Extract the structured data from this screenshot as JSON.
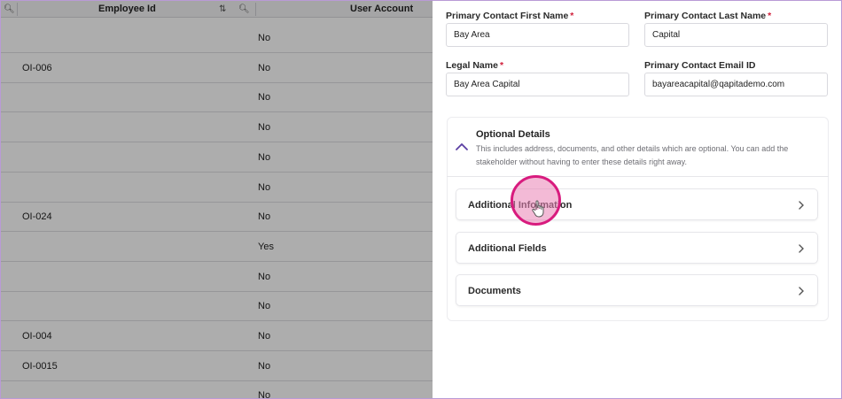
{
  "table": {
    "headers": {
      "employee_id": "Employee Id",
      "user_account": "User Account"
    },
    "rows": [
      {
        "employee_id": "",
        "user_account": "No"
      },
      {
        "employee_id": "OI-006",
        "user_account": "No"
      },
      {
        "employee_id": "",
        "user_account": "No"
      },
      {
        "employee_id": "",
        "user_account": "No"
      },
      {
        "employee_id": "",
        "user_account": "No"
      },
      {
        "employee_id": "",
        "user_account": "No"
      },
      {
        "employee_id": "OI-024",
        "user_account": "No"
      },
      {
        "employee_id": "",
        "user_account": "Yes"
      },
      {
        "employee_id": "",
        "user_account": "No"
      },
      {
        "employee_id": "",
        "user_account": "No"
      },
      {
        "employee_id": "OI-004",
        "user_account": "No"
      },
      {
        "employee_id": "OI-0015",
        "user_account": "No"
      },
      {
        "employee_id": "",
        "user_account": "No"
      }
    ]
  },
  "form": {
    "first_name": {
      "label": "Primary Contact First Name",
      "required": "*",
      "value": "Bay Area"
    },
    "last_name": {
      "label": "Primary Contact Last Name",
      "required": "*",
      "value": "Capital"
    },
    "legal_name": {
      "label": "Legal Name",
      "required": "*",
      "value": "Bay Area Capital"
    },
    "email": {
      "label": "Primary Contact Email ID",
      "value": "bayareacapital@qapitademo.com"
    }
  },
  "optional": {
    "title": "Optional Details",
    "description": "This includes address, documents, and other details which are optional. You can add the stakeholder without having to enter these details right away.",
    "sections": [
      "Additional Information",
      "Additional Fields",
      "Documents"
    ]
  },
  "colors": {
    "required": "#d0203b",
    "accent": "#5b3fa3",
    "cursor": "#d81b7e"
  }
}
